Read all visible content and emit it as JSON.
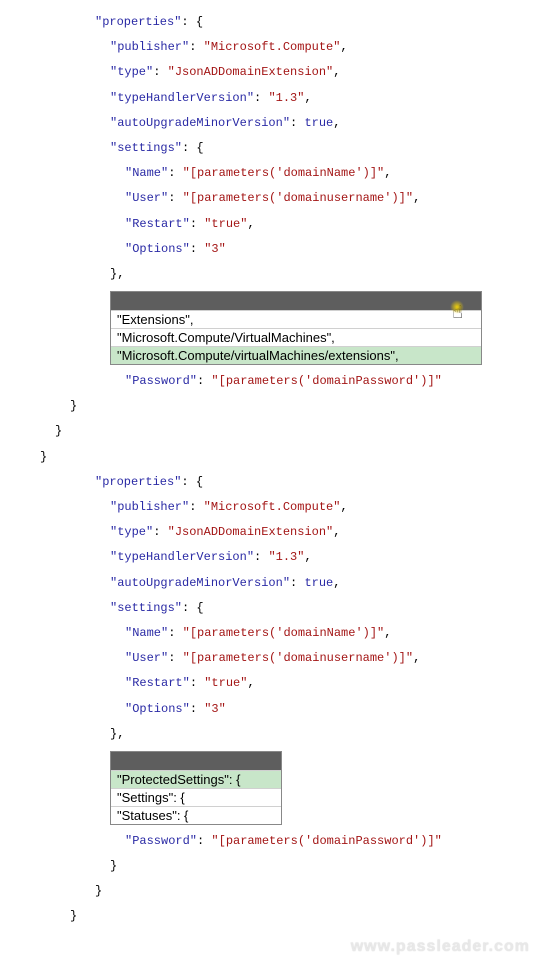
{
  "block1": {
    "properties_label": "\"properties\"",
    "publisher_key": "\"publisher\"",
    "publisher_val": "\"Microsoft.Compute\"",
    "type_key": "\"type\"",
    "type_val": "\"JsonADDomainExtension\"",
    "thv_key": "\"typeHandlerVersion\"",
    "thv_val": "\"1.3\"",
    "aumv_key": "\"autoUpgradeMinorVersion\"",
    "aumv_val": "true",
    "settings_key": "\"settings\"",
    "name_key": "\"Name\"",
    "name_val": "\"[parameters('domainName')]\"",
    "user_key": "\"User\"",
    "user_val": "\"[parameters('domainusername')]\"",
    "restart_key": "\"Restart\"",
    "restart_val": "\"true\"",
    "options_key": "\"Options\"",
    "options_val": "\"3\"",
    "password_key": "\"Password\"",
    "password_val": "\"[parameters('domainPassword')]\""
  },
  "dropdown1": {
    "opt1": "\"Extensions\",",
    "opt2": "\"Microsoft.Compute/VirtualMachines\",",
    "opt3": "\"Microsoft.Compute/virtualMachines/extensions\","
  },
  "block2": {
    "properties_label": "\"properties\"",
    "publisher_key": "\"publisher\"",
    "publisher_val": "\"Microsoft.Compute\"",
    "type_key": "\"type\"",
    "type_val": "\"JsonADDomainExtension\"",
    "thv_key": "\"typeHandlerVersion\"",
    "thv_val": "\"1.3\"",
    "aumv_key": "\"autoUpgradeMinorVersion\"",
    "aumv_val": "true",
    "settings_key": "\"settings\"",
    "name_key": "\"Name\"",
    "name_val": "\"[parameters('domainName')]\"",
    "user_key": "\"User\"",
    "user_val": "\"[parameters('domainusername')]\"",
    "restart_key": "\"Restart\"",
    "restart_val": "\"true\"",
    "options_key": "\"Options\"",
    "options_val": "\"3\"",
    "password_key": "\"Password\"",
    "password_val": "\"[parameters('domainPassword')]\""
  },
  "dropdown2": {
    "opt1": "\"ProtectedSettings\": {",
    "opt2": "\"Settings\": {",
    "opt3": "\"Statuses\": {"
  },
  "watermark": "www.passleader.com"
}
